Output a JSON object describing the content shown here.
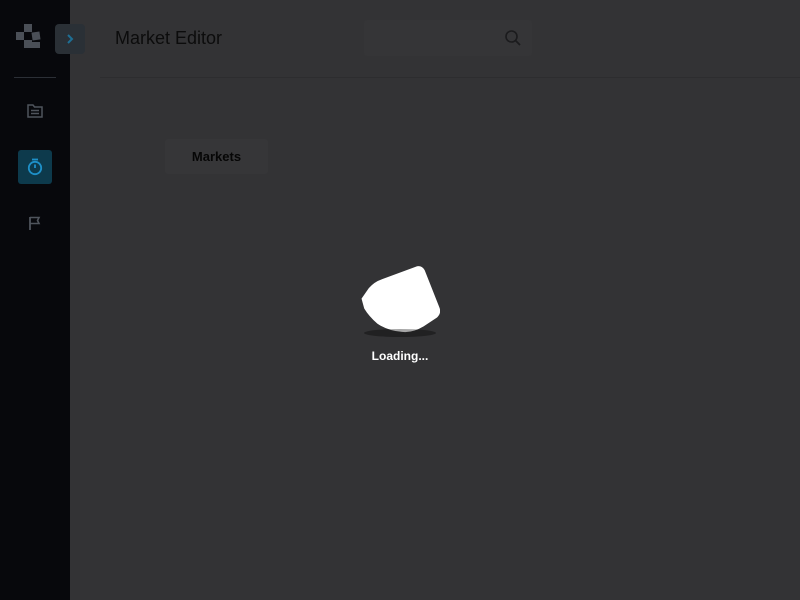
{
  "app": {
    "logo_icon": "app-logo-icon"
  },
  "sidebar": {
    "toggle_icon": "chevron-right-icon",
    "items": [
      {
        "icon": "file-list-icon",
        "active": false
      },
      {
        "icon": "stopwatch-icon",
        "active": true
      },
      {
        "icon": "flag-icon",
        "active": false
      }
    ]
  },
  "header": {
    "title": "Market Editor",
    "search": {
      "value": "",
      "placeholder": "",
      "icon": "search-icon"
    }
  },
  "main": {
    "tabs": [
      {
        "label": "Markets"
      }
    ]
  },
  "loader": {
    "text": "Loading..."
  },
  "colors": {
    "sidebar_bg": "#07080c",
    "overlay_bg": "#333335",
    "active_item_bg": "#0d3a4c",
    "accent": "#1e90c8"
  }
}
